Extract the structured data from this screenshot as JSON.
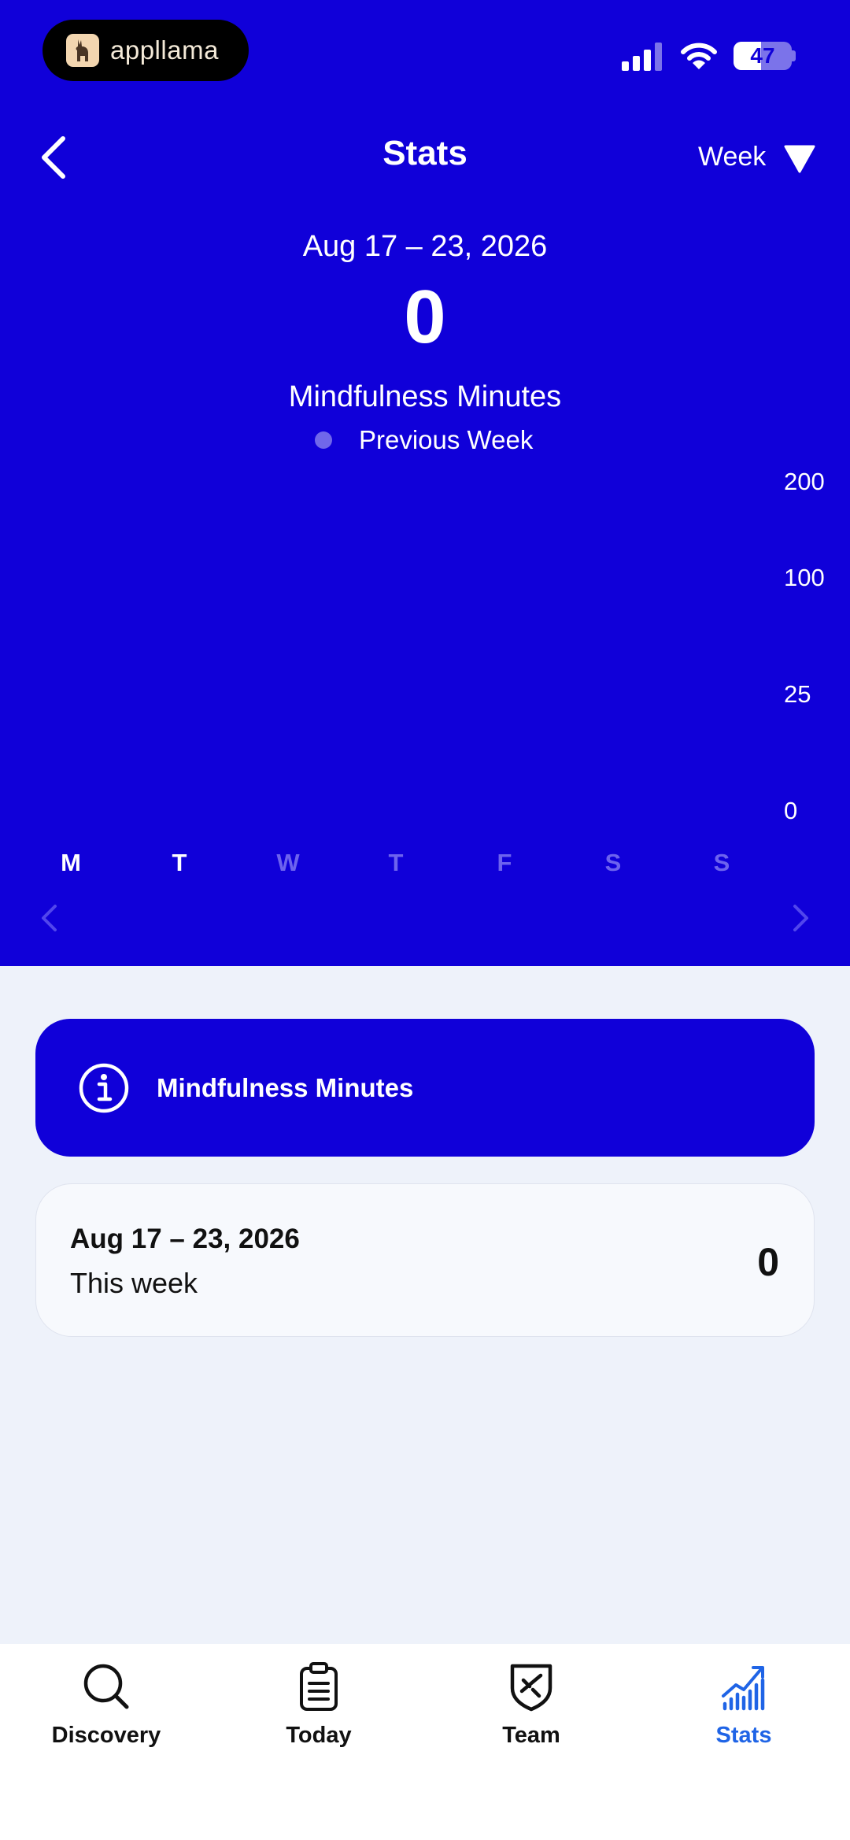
{
  "status_bar": {
    "app_pill_text": "appllama",
    "battery_level": "47",
    "battery_fraction": 0.47
  },
  "header": {
    "title": "Stats",
    "period_selector": "Week",
    "date_range": "Aug 17 – 23, 2026",
    "total_value": "0",
    "metric_label": "Mindfulness Minutes",
    "legend_label": "Previous Week"
  },
  "chart_data": {
    "type": "bar",
    "categories": [
      "M",
      "T",
      "W",
      "T",
      "F",
      "S",
      "S"
    ],
    "values": [
      0,
      0,
      0,
      0,
      0,
      0,
      0
    ],
    "y_ticks": [
      "200",
      "100",
      "25",
      "0"
    ],
    "active_days": [
      true,
      true,
      false,
      false,
      false,
      false,
      false
    ],
    "colors": {
      "background": "#1000d9",
      "active_day": "#ffffff",
      "inactive_day": "#6d63ee",
      "legend_dot": "#7067ea"
    }
  },
  "info_card": {
    "label": "Mindfulness Minutes"
  },
  "summary_card": {
    "date_range": "Aug 17 – 23, 2026",
    "subtitle": "This week",
    "value": "0"
  },
  "tab_bar": {
    "tabs": [
      {
        "label": "Discovery",
        "icon": "search-icon"
      },
      {
        "label": "Today",
        "icon": "clipboard-icon"
      },
      {
        "label": "Team",
        "icon": "shield-icon"
      },
      {
        "label": "Stats",
        "icon": "chart-icon",
        "selected": true
      }
    ],
    "selected_color": "#1f64e6"
  }
}
